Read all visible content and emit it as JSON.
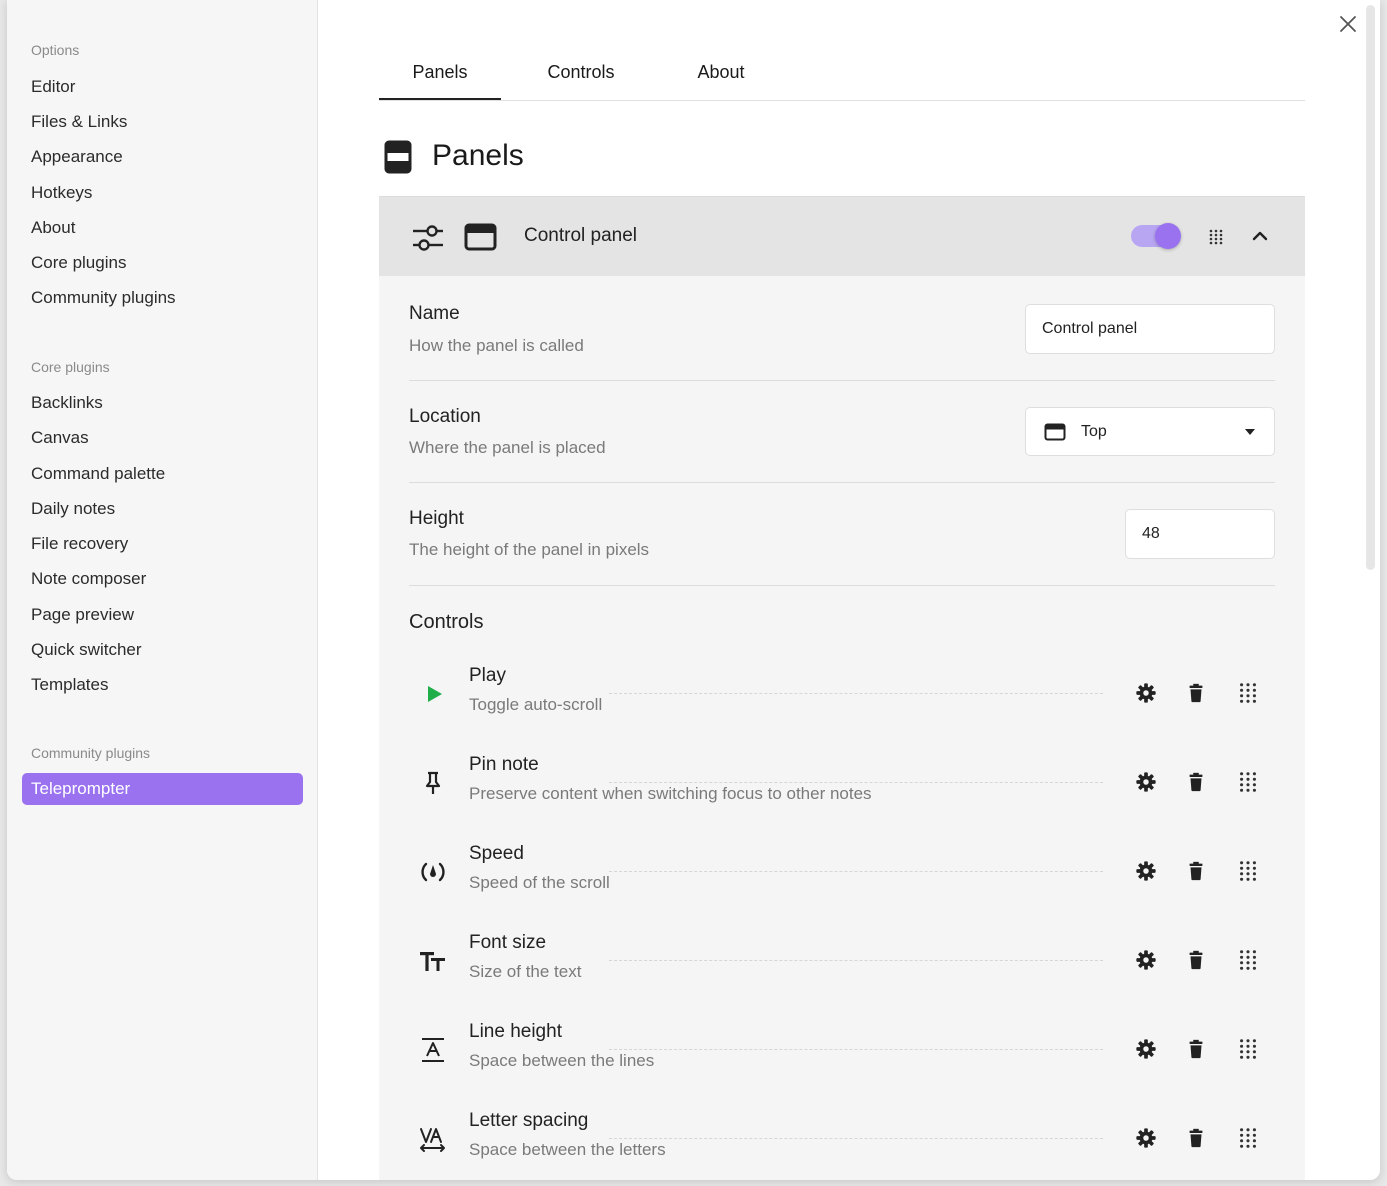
{
  "sidebar": {
    "options_heading": "Options",
    "options_items": [
      {
        "label": "Editor"
      },
      {
        "label": "Files & Links"
      },
      {
        "label": "Appearance"
      },
      {
        "label": "Hotkeys"
      },
      {
        "label": "About"
      },
      {
        "label": "Core plugins"
      },
      {
        "label": "Community plugins"
      }
    ],
    "core_heading": "Core plugins",
    "core_items": [
      {
        "label": "Backlinks"
      },
      {
        "label": "Canvas"
      },
      {
        "label": "Command palette"
      },
      {
        "label": "Daily notes"
      },
      {
        "label": "File recovery"
      },
      {
        "label": "Note composer"
      },
      {
        "label": "Page preview"
      },
      {
        "label": "Quick switcher"
      },
      {
        "label": "Templates"
      }
    ],
    "community_heading": "Community plugins",
    "community_items": [
      {
        "label": "Teleprompter",
        "active": true
      }
    ]
  },
  "tabs": [
    {
      "label": "Panels",
      "active": true
    },
    {
      "label": "Controls"
    },
    {
      "label": "About"
    }
  ],
  "page": {
    "title": "Panels",
    "icon": "panel-icon"
  },
  "panel": {
    "name": "Control panel",
    "enabled": true,
    "icons": [
      "sliders-icon",
      "panel-top-icon",
      "drag-handle-icon",
      "chevron-up-icon"
    ],
    "settings": {
      "name_label": "Name",
      "name_desc": "How the panel is called",
      "name_value": "Control panel",
      "location_label": "Location",
      "location_desc": "Where the panel is placed",
      "location_value": "Top",
      "height_label": "Height",
      "height_desc": "The height of the panel in pixels",
      "height_value": "48"
    },
    "controls_heading": "Controls",
    "controls": [
      {
        "name": "Play",
        "desc": "Toggle auto-scroll",
        "icon": "play-icon"
      },
      {
        "name": "Pin note",
        "desc": "Preserve content when switching focus to other notes",
        "icon": "pin-icon"
      },
      {
        "name": "Speed",
        "desc": "Speed of the scroll",
        "icon": "speed-icon"
      },
      {
        "name": "Font size",
        "desc": "Size of the text",
        "icon": "font-size-icon"
      },
      {
        "name": "Line height",
        "desc": "Space between the lines",
        "icon": "line-height-icon"
      },
      {
        "name": "Letter spacing",
        "desc": "Space between the letters",
        "icon": "letter-spacing-icon"
      }
    ]
  },
  "colors": {
    "accent": "#9a72f0",
    "play": "#1fae4a"
  }
}
